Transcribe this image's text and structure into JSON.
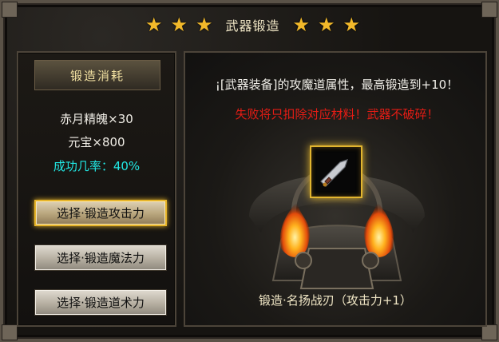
{
  "title": "武器锻造",
  "stars": [
    "★",
    "★",
    "★",
    "★",
    "★",
    "★"
  ],
  "left": {
    "cost_header": "锻造消耗",
    "cost_lines": [
      "赤月精魄×30",
      "元宝×800"
    ],
    "success_rate": "成功几率：40%",
    "buttons": [
      "选择·锻造攻击力",
      "选择·锻造魔法力",
      "选择·锻造道术力"
    ]
  },
  "right": {
    "info": "¡[武器装备]的攻魔道属性，最高锻造到+10！",
    "warning": "失败将只扣除对应材料！武器不破碎！",
    "result": "锻造·名扬战刃（攻击力+1）"
  },
  "colors": {
    "accent": "#e2b52f",
    "warning": "#e41c15",
    "success": "#21e7e3"
  },
  "icons": {
    "slot_item": "sword-icon",
    "stars": "star-icon"
  }
}
